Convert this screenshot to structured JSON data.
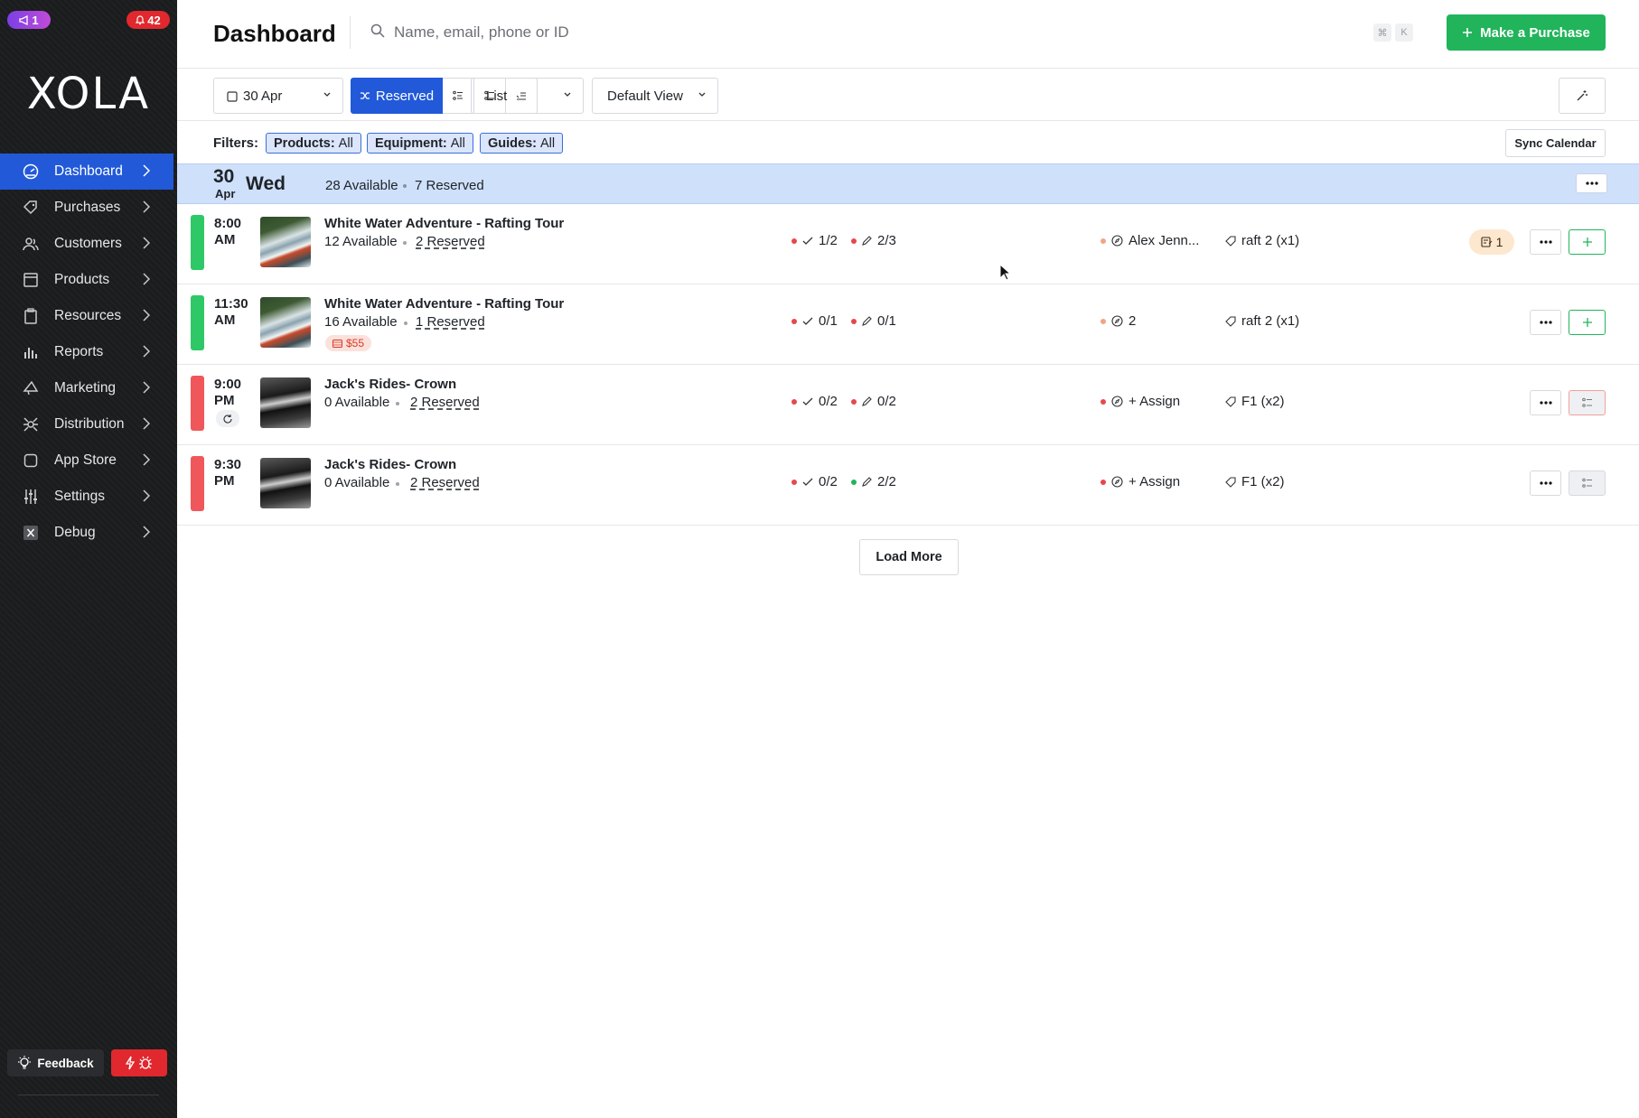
{
  "sidebar": {
    "announce_count": "1",
    "notification_count": "42",
    "logo": "XOLA",
    "items": [
      {
        "label": "Dashboard",
        "icon": "dashboard-icon"
      },
      {
        "label": "Purchases",
        "icon": "tag-icon"
      },
      {
        "label": "Customers",
        "icon": "users-icon"
      },
      {
        "label": "Products",
        "icon": "box-icon"
      },
      {
        "label": "Resources",
        "icon": "clipboard-icon"
      },
      {
        "label": "Reports",
        "icon": "bar-chart-icon"
      },
      {
        "label": "Marketing",
        "icon": "megaphone-icon"
      },
      {
        "label": "Distribution",
        "icon": "distribution-icon"
      },
      {
        "label": "App Store",
        "icon": "app-store-icon"
      },
      {
        "label": "Settings",
        "icon": "sliders-icon"
      },
      {
        "label": "Debug",
        "icon": "debug-x-icon"
      }
    ],
    "feedback_label": "Feedback"
  },
  "header": {
    "title": "Dashboard",
    "search_placeholder": "Name, email, phone or ID",
    "kbd_cmd": "⌘",
    "kbd_k": "K",
    "purchase_label": "Make a Purchase"
  },
  "toolbar": {
    "date": "30 Apr",
    "reserved_label": "Reserved",
    "layout": "List",
    "view": "Default View"
  },
  "filters": {
    "label": "Filters:",
    "chips": [
      {
        "name": "Products:",
        "value": "All"
      },
      {
        "name": "Equipment:",
        "value": "All"
      },
      {
        "name": "Guides:",
        "value": "All"
      }
    ],
    "sync_label": "Sync Calendar"
  },
  "day": {
    "num": "30",
    "month": "Apr",
    "weekday": "Wed",
    "available": "28 Available",
    "reserved": "7 Reserved"
  },
  "rows": [
    {
      "time1": "8:00",
      "time2": "AM",
      "status_color": "#2ec866",
      "name": "White Water Adventure - Rafting Tour",
      "available": "12 Available",
      "reserved": "2 Reserved",
      "checkin": "1/2",
      "waiver": "2/3",
      "guide": "Alex Jenn...",
      "equipment": "raft 2 (x1)",
      "notes": "1"
    },
    {
      "time1": "11:30",
      "time2": "AM",
      "status_color": "#2ec866",
      "name": "White Water Adventure - Rafting Tour",
      "available": "16 Available",
      "reserved": "1 Reserved",
      "price": "$55",
      "checkin": "0/1",
      "waiver": "0/1",
      "guide": "2",
      "equipment": "raft 2 (x1)"
    },
    {
      "time1": "9:00",
      "time2": "PM",
      "status_color": "#f0575a",
      "name": "Jack's Rides- Crown",
      "available": "0 Available",
      "reserved": "2 Reserved",
      "checkin": "0/2",
      "waiver": "0/2",
      "guide": "+ Assign",
      "equipment": "F1 (x2)"
    },
    {
      "time1": "9:30",
      "time2": "PM",
      "status_color": "#f0575a",
      "name": "Jack's Rides- Crown",
      "available": "0 Available",
      "reserved": "2 Reserved",
      "checkin": "0/2",
      "waiver": "2/2",
      "guide": "+ Assign",
      "equipment": "F1 (x2)"
    }
  ],
  "load_more_label": "Load More",
  "colors": {
    "brand_blue": "#2159d9",
    "green": "#21b45a",
    "red": "#e0282e"
  }
}
